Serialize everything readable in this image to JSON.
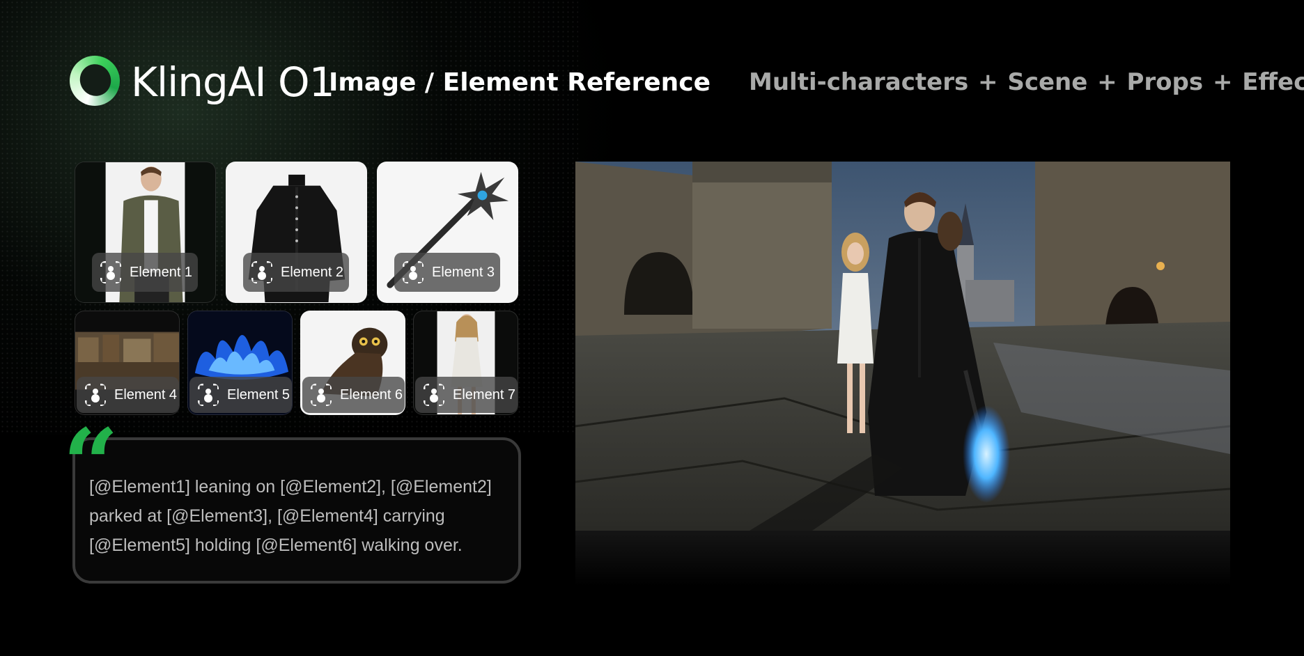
{
  "header": {
    "logo_text": "KlingAI O1",
    "subtitle": "Image / Element Reference",
    "tagline": "Multi-characters + Scene  + Props + Effect"
  },
  "elements": [
    {
      "label": "Element 1",
      "icon": "element-reference-icon"
    },
    {
      "label": "Element 2",
      "icon": "element-reference-icon"
    },
    {
      "label": "Element 3",
      "icon": "element-reference-icon"
    },
    {
      "label": "Element 4",
      "icon": "element-reference-icon"
    },
    {
      "label": "Element 5",
      "icon": "element-reference-icon"
    },
    {
      "label": "Element 6",
      "icon": "element-reference-icon"
    },
    {
      "label": "Element 7",
      "icon": "element-reference-icon"
    }
  ],
  "prompt": {
    "quote_mark": "“",
    "text": "[@Element1] leaning on [@Element2], [@Element2] parked at [@Element3], [@Element4] carrying [@Element5] holding [@Element6] walking over."
  },
  "colors": {
    "accent_green": "#22b14a",
    "tagline_gray": "#a9aaa9",
    "prompt_text": "#bdbdbd"
  }
}
